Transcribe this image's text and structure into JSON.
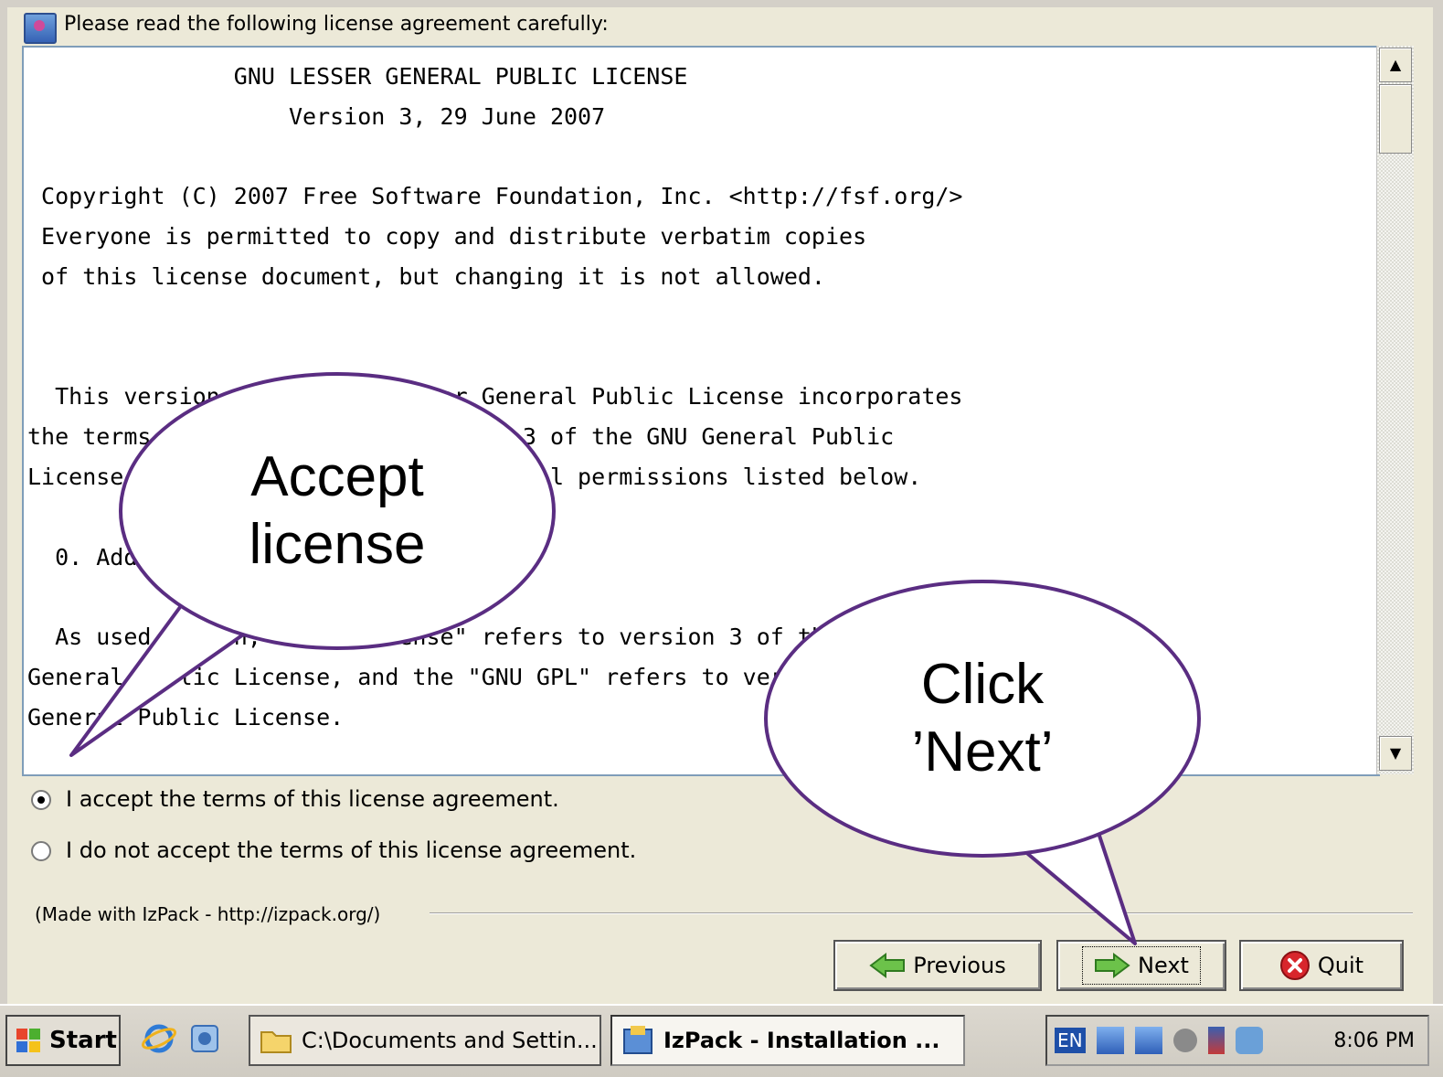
{
  "header": {
    "text": "Please read the following license agreement carefully:"
  },
  "license_text": "               GNU LESSER GENERAL PUBLIC LICENSE\n                   Version 3, 29 June 2007\n\n Copyright (C) 2007 Free Software Foundation, Inc. <http://fsf.org/>\n Everyone is permitted to copy and distribute verbatim copies\n of this license document, but changing it is not allowed.\n\n\n  This version of the GNU Lesser General Public License incorporates\nthe terms and conditions of version 3 of the GNU General Public\nLicense, supplemented by the additional permissions listed below.\n\n  0. Additional Definitions.\n\n  As used herein, \"this License\" refers to version 3 of the GNU Lesser\nGeneral Public License, and the \"GNU GPL\" refers to version 3 of the GNU\nGeneral Public License.",
  "scrollbar": {
    "up_icon": "up-arrow-icon",
    "down_icon": "down-arrow-icon"
  },
  "radios": {
    "accept": {
      "label": "I accept the terms of this license agreement.",
      "checked": true
    },
    "decline": {
      "label": "I do not accept the terms of this license agreement.",
      "checked": false
    }
  },
  "credit": "(Made with IzPack - http://izpack.org/)",
  "buttons": {
    "previous": "Previous",
    "next": "Next",
    "quit": "Quit"
  },
  "taskbar": {
    "start": "Start",
    "task_explorer": "C:\\Documents and Settin...",
    "task_izpack": "IzPack - Installation ...",
    "lang": "EN",
    "clock": "8:06 PM"
  },
  "callouts": {
    "accept": "Accept\nlicense",
    "next": "Click\n’Next’"
  },
  "colors": {
    "callout_border": "#5a2d82",
    "window_bg": "#ece9d8",
    "textbox_border": "#7f9db9"
  }
}
